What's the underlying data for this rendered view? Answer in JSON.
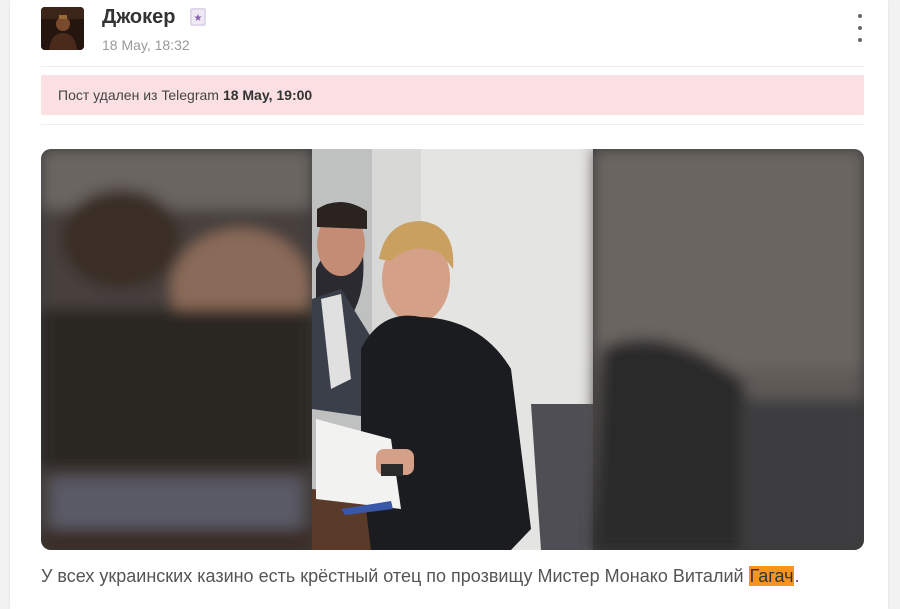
{
  "post": {
    "author": "Джокер",
    "date": "18 May, 18:32",
    "deleted_notice": {
      "text": "Пост удален из Telegram",
      "date": "18 May, 19:00",
      "background": "#fbe0e3"
    },
    "caption_prefix": "У всех украинских казино есть крёстный отец по прозвищу Мистер Монако Виталий ",
    "caption_highlight": "Гагач",
    "caption_suffix": ".",
    "highlight_color": "#f7941d",
    "icons": {
      "menu": "more-vertical-icon",
      "badge": "joker-card-icon"
    }
  }
}
